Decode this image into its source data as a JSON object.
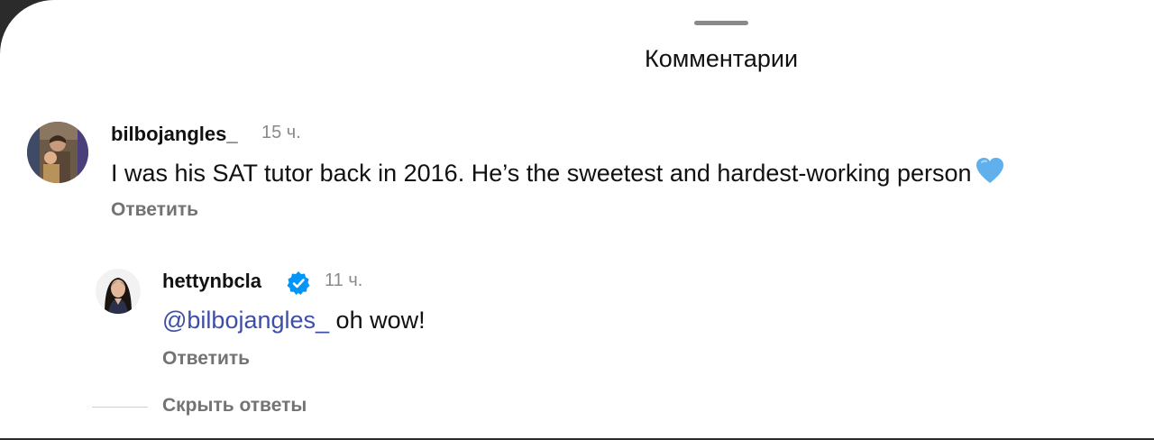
{
  "sheet": {
    "title": "Комментарии"
  },
  "comments": [
    {
      "username": "bilbojangles_",
      "time": "15 ч.",
      "text": "I was his SAT tutor back in 2016. He’s the sweetest and hardest-working person",
      "emoji": "blue-heart",
      "reply_label": "Ответить"
    },
    {
      "username": "hettynbcla",
      "verified": true,
      "time": "11 ч.",
      "mention": "@bilbojangles_",
      "text": " oh wow!",
      "reply_label": "Ответить"
    }
  ],
  "replies": {
    "hide_label": "Скрыть ответы"
  },
  "colors": {
    "mention": "#3d4ea8",
    "verified": "#0095f6",
    "heart": "#5fb0ec",
    "secondary_text": "#737373"
  }
}
